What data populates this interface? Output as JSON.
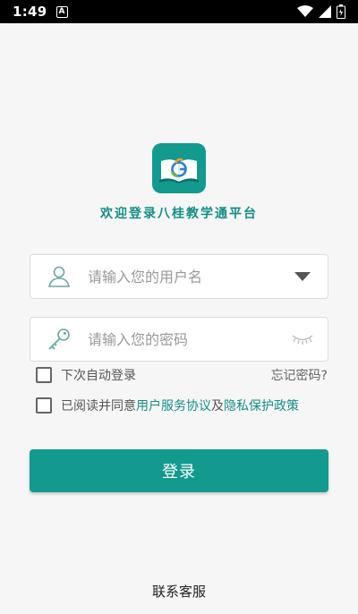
{
  "status_bar": {
    "time": "1:49",
    "notif_letter": "A"
  },
  "app": {
    "welcome": "欢迎登录八桂教学通平台",
    "logo_icon": "book-logo-icon"
  },
  "form": {
    "username_placeholder": "请输入您的用户名",
    "password_placeholder": "请输入您的密码"
  },
  "options": {
    "remember_label": "下次自动登录",
    "forgot_label": "忘记密码?",
    "agree_prefix": "已阅读并同意",
    "service_link": "用户服务协议",
    "and_text": "及",
    "privacy_link": "隐私保护政策"
  },
  "login_button": "登录",
  "contact": "联系客服",
  "colors": {
    "accent": "#139a8e",
    "link": "#148f85",
    "background": "#f6f6f6"
  }
}
